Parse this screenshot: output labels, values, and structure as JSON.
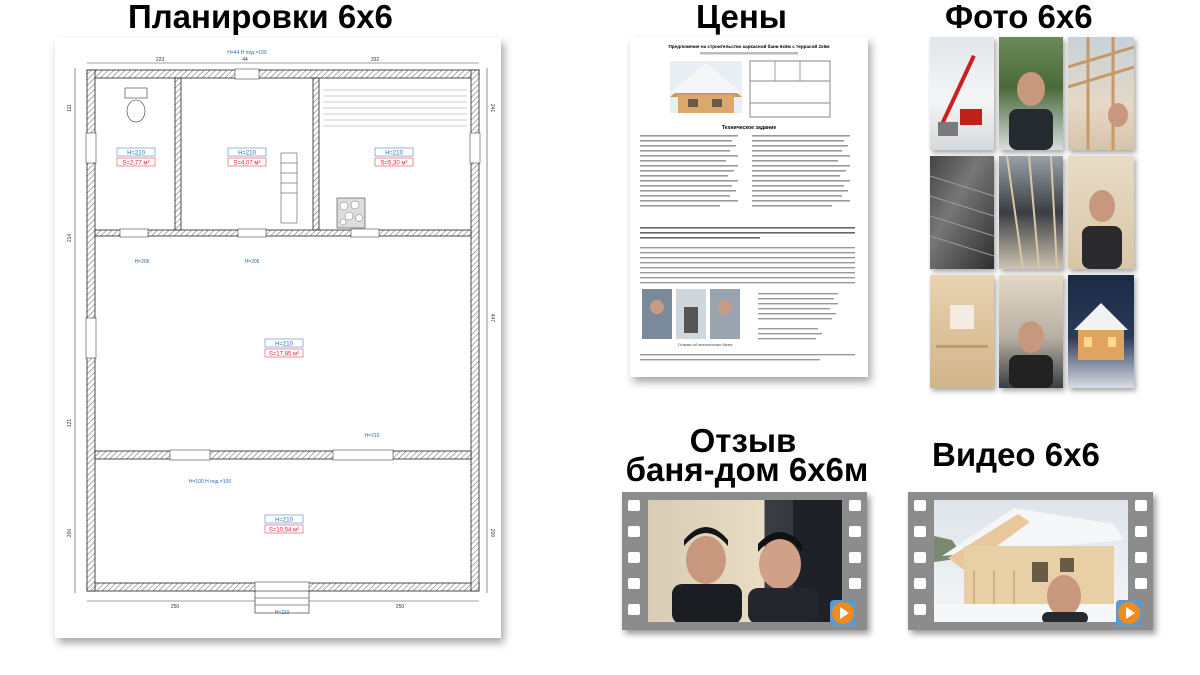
{
  "sections": {
    "plans": {
      "title": "Планировки 6х6"
    },
    "prices": {
      "title": "Цены"
    },
    "photos": {
      "title": "Фото 6х6"
    },
    "review": {
      "title_line1": "Отзыв",
      "title_line2": "баня-дом 6х6м"
    },
    "video": {
      "title": "Видео 6х6"
    }
  },
  "floor_plan": {
    "dims_top": [
      "223",
      "44",
      "332"
    ],
    "dims_bottom": [
      "250",
      "100",
      "250"
    ],
    "dims_left": [
      "111",
      "214",
      "121",
      "200"
    ],
    "dims_right": [
      "241",
      "447",
      "200"
    ],
    "rooms": [
      {
        "h": "H=210",
        "s": "S=2,77 м²"
      },
      {
        "h": "H=210",
        "s": "S=4,07 м²"
      },
      {
        "h": "H=210",
        "s": "S=5,30 м²"
      },
      {
        "h": "H=210",
        "s": "S=17,85 м²"
      },
      {
        "h": "H=210",
        "s": "S=10,54 м²"
      }
    ],
    "labels": {
      "top_door": "H=44  H под.=100",
      "mid_door1": "H=206",
      "mid_door2": "H=206",
      "lower_door": "H=210",
      "window_lower": "H=100  H под.=100",
      "bottom_door": "H=210"
    }
  },
  "price_doc": {
    "heading": "Предложение на строительство каркасной бани 6х6м с террасой 2х6м",
    "subheading": "Техническое задание",
    "footer": "Отзывы об аналогичных банях"
  },
  "colors": {
    "play": "#f28a1c",
    "film": "#8c8c8c",
    "area_red": "#e0202a",
    "label_blue": "#2a6fc0"
  }
}
